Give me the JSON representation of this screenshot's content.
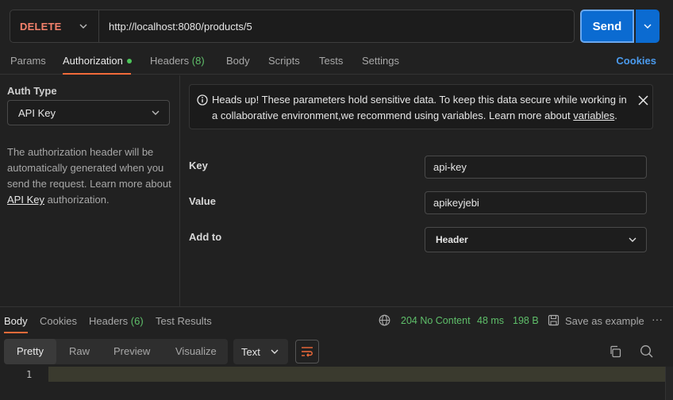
{
  "request": {
    "method": "DELETE",
    "url": "http://localhost:8080/products/5",
    "send_label": "Send"
  },
  "tabs": {
    "params": "Params",
    "authorization": "Authorization",
    "headers": "Headers",
    "headers_count": "(8)",
    "body": "Body",
    "scripts": "Scripts",
    "tests": "Tests",
    "settings": "Settings",
    "cookies": "Cookies"
  },
  "auth": {
    "type_label": "Auth Type",
    "type_value": "API Key",
    "description_pre": "The authorization header will be automatically generated when you send the request. Learn more about ",
    "description_link": "API Key",
    "description_post": " authorization."
  },
  "alert": {
    "text_pre": "Heads up! These parameters hold sensitive data. To keep this data secure while working in a collaborative environment,we recommend using variables. Learn more about ",
    "link": "variables",
    "text_post": "."
  },
  "form": {
    "key_label": "Key",
    "key_value": "api-key",
    "value_label": "Value",
    "value_value": "apikeyjebi",
    "addto_label": "Add to",
    "addto_value": "Header"
  },
  "response": {
    "tabs": {
      "body": "Body",
      "cookies": "Cookies",
      "headers": "Headers",
      "headers_count": "(6)",
      "test_results": "Test Results"
    },
    "status": "204 No Content",
    "time": "48 ms",
    "size": "198 B",
    "save_label": "Save as example",
    "more": "···",
    "formats": {
      "pretty": "Pretty",
      "raw": "Raw",
      "preview": "Preview",
      "visualize": "Visualize"
    },
    "text_type": "Text",
    "line_number": "1"
  },
  "colors": {
    "method": "#f4816b",
    "send": "#0b6bd1",
    "accent_underline": "#f26b3a",
    "success": "#5fbf6a",
    "link": "#4b9bee"
  }
}
